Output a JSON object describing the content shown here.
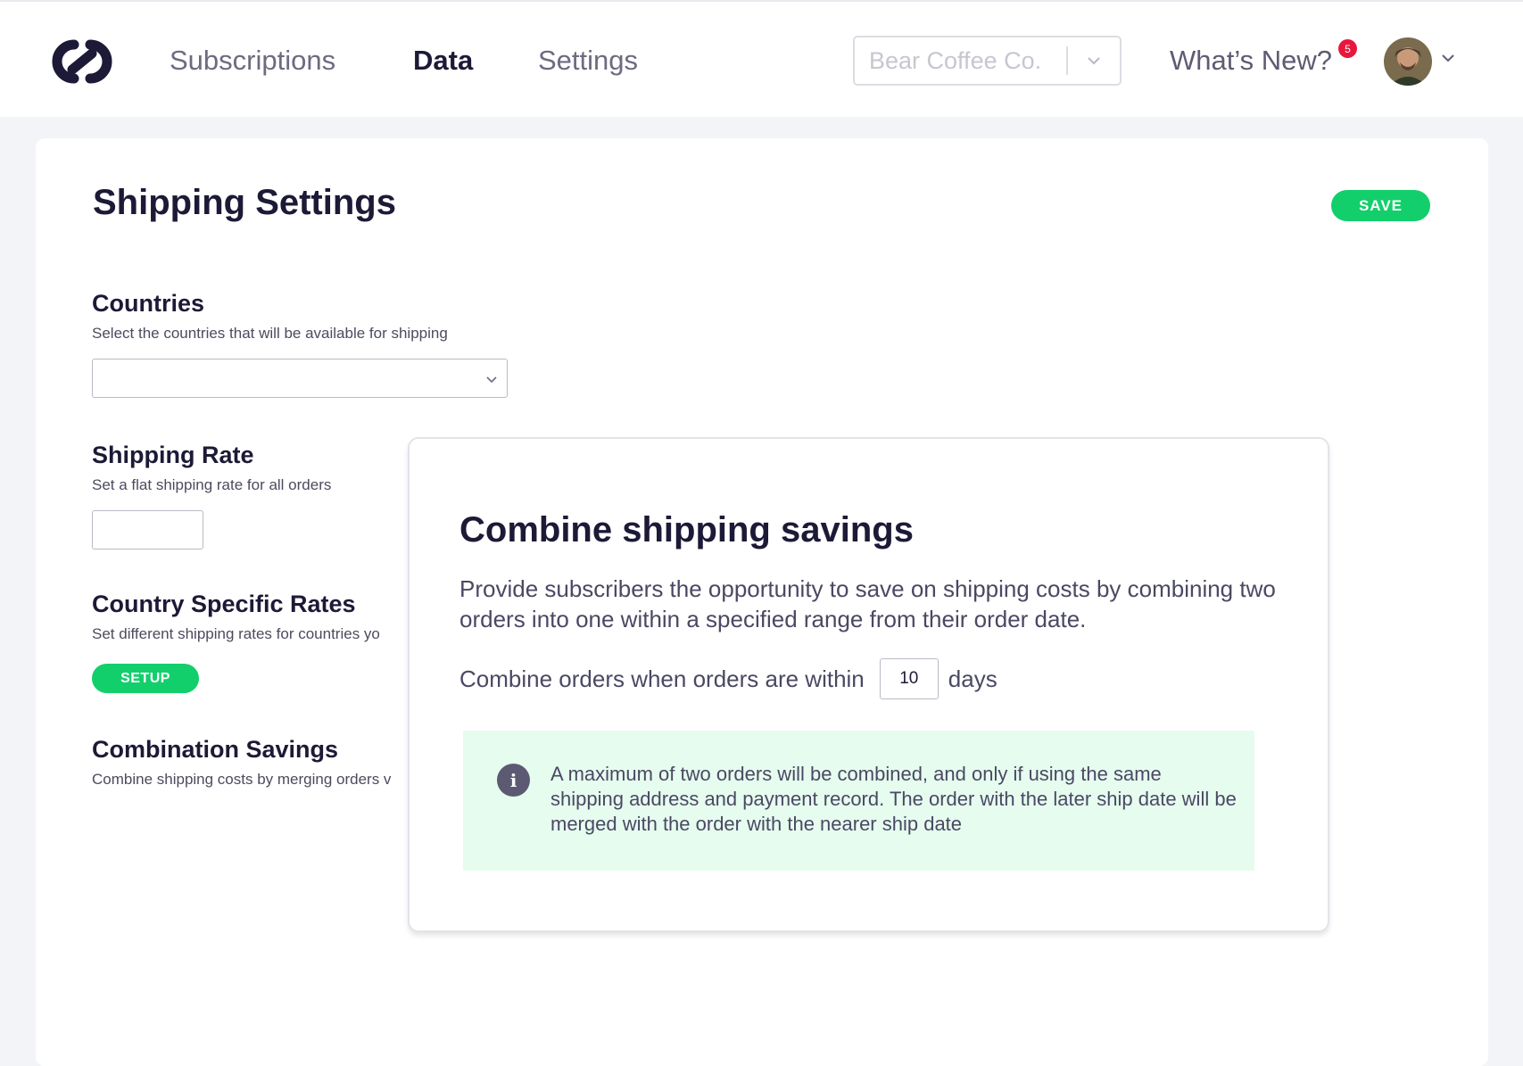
{
  "nav": {
    "items": [
      {
        "label": "Subscriptions",
        "active": false
      },
      {
        "label": "Data",
        "active": true
      },
      {
        "label": "Settings",
        "active": false
      }
    ],
    "store_select": {
      "value": "Bear Coffee Co."
    },
    "whats_new": "What’s New?",
    "notification_count": "5"
  },
  "page": {
    "title": "Shipping Settings",
    "save_label": "SAVE"
  },
  "sections": {
    "countries": {
      "title": "Countries",
      "description": "Select the countries that will be available for shipping",
      "selected_value": ""
    },
    "shipping_rate": {
      "title": "Shipping Rate",
      "description": "Set a flat shipping rate for all orders",
      "value": ""
    },
    "country_rates": {
      "title": "Country Specific Rates",
      "description": "Set different shipping rates for countries yo",
      "button_label": "SETUP"
    },
    "combination": {
      "title": "Combination Savings",
      "description": "Combine shipping costs by merging orders v"
    }
  },
  "modal": {
    "title": "Combine shipping savings",
    "description": "Provide subscribers the opportunity to save on shipping costs by combining two orders into one within a specified range from their order date.",
    "combine_prefix": "Combine orders when orders are within",
    "days_value": "10",
    "combine_suffix": "days",
    "info_icon_label": "i",
    "info_text": "A maximum of two orders will be combined, and only if using the same shipping address and payment record. The order with the later ship date will be merged with the order with the nearer ship date"
  },
  "colors": {
    "accent_green": "#12cf6b",
    "info_bg": "#e6fcef",
    "badge_red": "#e8173d",
    "text_dark": "#1c1a36"
  }
}
